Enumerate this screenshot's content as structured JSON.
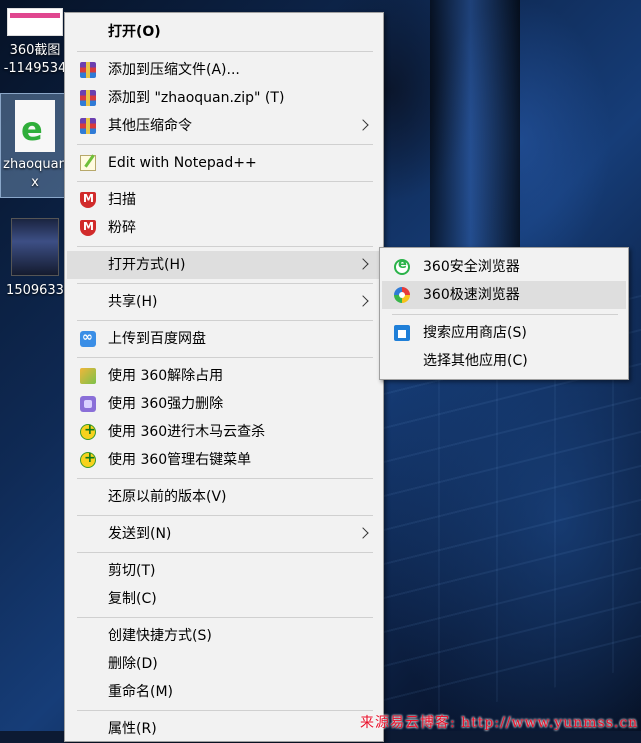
{
  "desktop": {
    "icons": [
      {
        "name": "screenshot-file",
        "label_line1": "360截图",
        "label_line2": "-1149534"
      },
      {
        "name": "zhaoquan-file",
        "label_line1": "zhaoquan",
        "label_line2": "x"
      },
      {
        "name": "video-file",
        "label_line1": "1509633"
      }
    ],
    "file_icon_glyph": "e"
  },
  "context_menu": {
    "items": [
      {
        "label": "打开(O)",
        "bold": true
      },
      {
        "label": "添加到压缩文件(A)...",
        "icon": "winrar-icon"
      },
      {
        "label": "添加到 \"zhaoquan.zip\" (T)",
        "icon": "winrar-icon"
      },
      {
        "label": "其他压缩命令",
        "icon": "winrar-icon",
        "submenu": true
      },
      {
        "label": "Edit with Notepad++",
        "icon": "notepad-plus-icon"
      },
      {
        "label": "扫描",
        "icon": "mcafee-shield-icon"
      },
      {
        "label": "粉碎",
        "icon": "mcafee-shield-icon"
      },
      {
        "label": "打开方式(H)",
        "submenu": true,
        "highlighted": true
      },
      {
        "label": "共享(H)",
        "submenu": true
      },
      {
        "label": "上传到百度网盘",
        "icon": "baidu-netdisk-icon"
      },
      {
        "label": "使用 360解除占用",
        "icon": "unlock-icon"
      },
      {
        "label": "使用 360强力删除",
        "icon": "force-delete-icon"
      },
      {
        "label": "使用 360进行木马云查杀",
        "icon": "360-safe-icon"
      },
      {
        "label": "使用 360管理右键菜单",
        "icon": "360-safe-icon"
      },
      {
        "label": "还原以前的版本(V)"
      },
      {
        "label": "发送到(N)",
        "submenu": true
      },
      {
        "label": "剪切(T)"
      },
      {
        "label": "复制(C)"
      },
      {
        "label": "创建快捷方式(S)"
      },
      {
        "label": "删除(D)"
      },
      {
        "label": "重命名(M)"
      },
      {
        "label": "属性(R)"
      }
    ]
  },
  "open_with_submenu": {
    "items": [
      {
        "label": "360安全浏览器",
        "icon": "360-secure-browser-icon"
      },
      {
        "label": "360极速浏览器",
        "icon": "360-extreme-browser-icon",
        "highlighted": true
      },
      {
        "label": "搜索应用商店(S)",
        "icon": "store-icon"
      },
      {
        "label": "选择其他应用(C)"
      }
    ]
  },
  "watermark": "来源易云博客: http://www.yunmss.cn"
}
